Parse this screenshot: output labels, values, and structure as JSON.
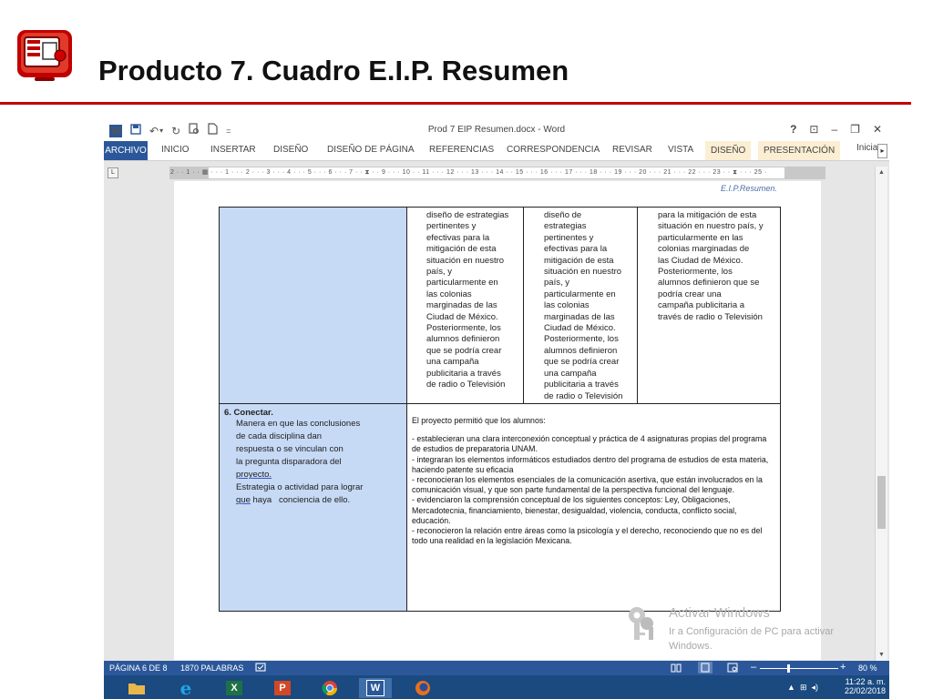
{
  "slide": {
    "title": "Producto 7. Cuadro E.I.P. Resumen",
    "accent_color": "#c00000",
    "logo_icon": "presentation-board-icon"
  },
  "word": {
    "doc_title": "Prod 7 EIP Resumen.docx - Word",
    "qat": {
      "word_icon": "W",
      "save_icon": "save-icon",
      "undo": "↶",
      "undo_dropdown": "▾",
      "redo": "↻",
      "print_preview_icon": "print-preview-icon",
      "new_icon": "new-document-icon",
      "customize": "="
    },
    "window_controls": {
      "help": "?",
      "ribbon_display": "⊡",
      "minimize": "–",
      "restore": "❐",
      "close": "✕"
    },
    "ribbon_tabs": [
      "ARCHIVO",
      "INICIO",
      "INSERTAR",
      "DISEÑO",
      "DISEÑO DE PÁGINA",
      "REFERENCIAS",
      "CORRESPONDENCIA",
      "REVISAR",
      "VISTA",
      "DISEÑO",
      "PRESENTACIÓN"
    ],
    "ribbon_overflow": "Inicia",
    "ribbon_scroll": "▸",
    "ruler_corner": "L",
    "ruler_text": "2 · · 1 · · ▦ · · · 1 · · · 2 · · · 3 · · · 4 · · · 5 · · · 6 · · · 7 · · ⧗ · · 9 · · · 10 · · 11 · · · 12 · · · 13 · · · 14 · · 15 · · · 16 · · · 17 · · · 18 · · · 19 · · · 20 · · · 21 · · · 22 · · · 23 · · ⧗ · · · 25 ·",
    "header_text": "E.I.P.Resumen.",
    "scroll_up": "▲",
    "scroll_down": "▼"
  },
  "table": {
    "row1": {
      "col2": [
        "diseño de estrategias",
        "pertinentes y",
        "efectivas para la",
        "mitigación de esta",
        "situación en nuestro",
        "país, y",
        "particularmente en",
        "las colonias",
        "marginadas de las",
        "Ciudad de México.",
        "Posteriormente, los",
        "alumnos definieron",
        "que se podría crear",
        "una campaña",
        "publicitaria a través",
        "de radio o Televisión"
      ],
      "col3": [
        "diseño de",
        "estrategias",
        "pertinentes y",
        "efectivas para la",
        "mitigación de esta",
        "situación en nuestro",
        "país, y",
        "particularmente en",
        "las colonias",
        "marginadas de las",
        "Ciudad de México.",
        "Posteriormente, los",
        "alumnos definieron",
        "que se podría crear",
        "una campaña",
        "publicitaria a través",
        "de radio o Televisión"
      ],
      "col4": [
        "para la mitigación de esta",
        "situación en nuestro país, y",
        "particularmente en las",
        "colonias marginadas de",
        "las Ciudad de México.",
        "Posteriormente, los",
        "alumnos definieron que se",
        "podría crear una",
        "campaña publicitaria a",
        "través de radio o Televisión"
      ]
    },
    "row2": {
      "title": "6. Conectar.",
      "lines": [
        "Manera en que las conclusiones",
        "de cada disciplina dan",
        "respuesta  o se vinculan con",
        "la pregunta  disparadora del"
      ],
      "proyecto": "proyecto.",
      "line_estrategia": "Estrategia o  actividad para lograr",
      "que": "que",
      "line_end": " haya   conciencia de ello.",
      "conclusion_intro": "El proyecto permitió que los alumnos:",
      "conclusion_items": [
        "- establecieran una clara interconexión conceptual y práctica de 4 asignaturas propias del programa de estudios de preparatoria UNAM.",
        "- integraran los elementos informáticos estudiados dentro del programa de estudios de esta materia, haciendo patente su eficacia",
        "- reconocieran los elementos esenciales de la comunicación asertiva, que están involucrados en la comunicación visual, y que son parte fundamental de la perspectiva funcional del lenguaje.",
        "- evidenciaron la comprensión conceptual de los siguientes conceptos: Ley, Obligaciones, Mercadotecnia, financiamiento, bienestar, desigualdad, violencia, conducta, conflicto social, educación.",
        "- reconocieron la relación entre áreas como la psicología y el derecho, reconociendo que no es del todo una realidad en la legislación Mexicana."
      ]
    }
  },
  "watermark": {
    "title": "Activar Windows",
    "subtitle": "Ir a Configuración de PC para activar Windows."
  },
  "status": {
    "page": "PÁGINA 6 DE 8",
    "words": "1870 PALABRAS",
    "proofing_icon": "proofing-icon",
    "view_icons": [
      "read-mode-icon",
      "print-layout-icon",
      "web-layout-icon"
    ],
    "zoom_minus": "–",
    "zoom_plus": "+",
    "zoom": "80 %"
  },
  "taskbar": {
    "apps": [
      {
        "name": "file-explorer",
        "label": "",
        "color": "#e8b84a"
      },
      {
        "name": "internet-explorer",
        "label": "e",
        "color": "#1fa3e8"
      },
      {
        "name": "excel",
        "label": "X",
        "color": "#1e7145"
      },
      {
        "name": "powerpoint",
        "label": "P",
        "color": "#d24726"
      },
      {
        "name": "chrome",
        "label": "",
        "color": "#e9b52a"
      },
      {
        "name": "word",
        "label": "W",
        "color": "#2b579a"
      },
      {
        "name": "firefox",
        "label": "",
        "color": "#e8701d"
      }
    ],
    "tray_icons": "▲  ⊞  ◂)",
    "time": "11:22 a. m.",
    "date": "22/02/2018"
  }
}
